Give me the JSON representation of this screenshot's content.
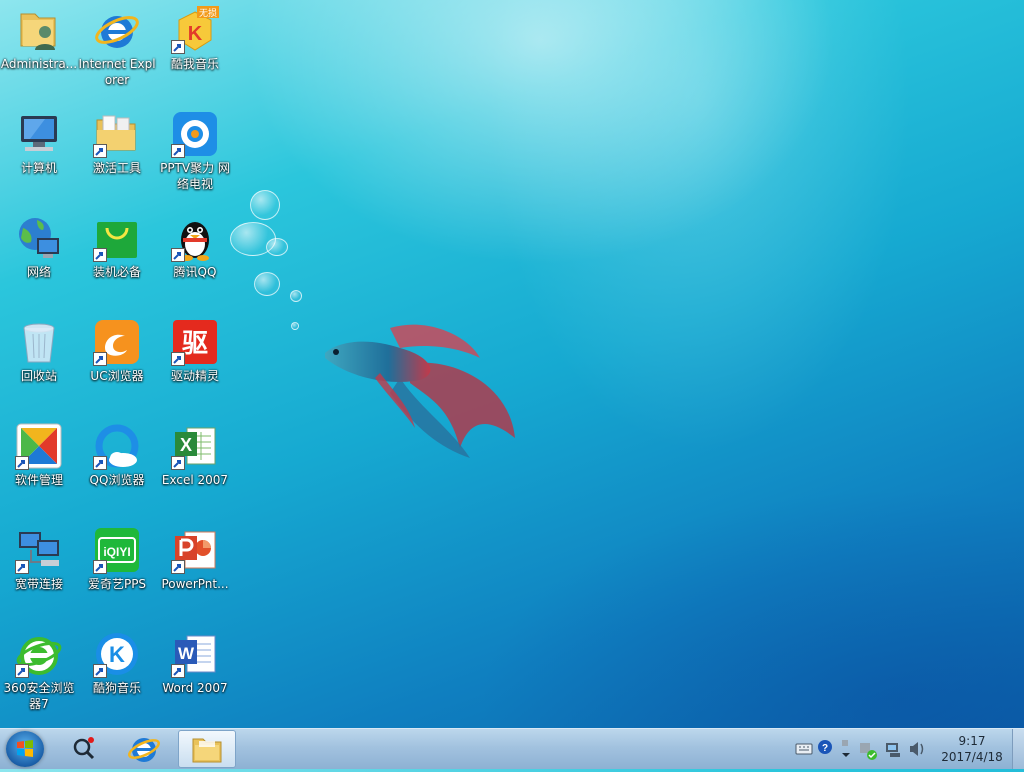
{
  "desktop": {
    "icons": [
      {
        "label": "Administra...",
        "icon": "user-folder-icon"
      },
      {
        "label": "Internet Explorer",
        "icon": "ie-icon"
      },
      {
        "label": "酷我音乐",
        "icon": "kuwo-music-icon",
        "badge": "无损"
      },
      {
        "label": "计算机",
        "icon": "computer-icon"
      },
      {
        "label": "激活工具",
        "icon": "folder-icon"
      },
      {
        "label": "PPTV聚力 网络电视",
        "icon": "pptv-icon"
      },
      {
        "label": "网络",
        "icon": "network-icon"
      },
      {
        "label": "装机必备",
        "icon": "shopping-bag-icon"
      },
      {
        "label": "腾讯QQ",
        "icon": "qq-penguin-icon"
      },
      {
        "label": "回收站",
        "icon": "recycle-bin-icon"
      },
      {
        "label": "UC浏览器",
        "icon": "uc-browser-icon"
      },
      {
        "label": "驱动精灵",
        "icon": "driver-genius-icon",
        "glyph": "驱"
      },
      {
        "label": "软件管理",
        "icon": "software-manager-icon"
      },
      {
        "label": "QQ浏览器",
        "icon": "qq-browser-icon"
      },
      {
        "label": "Excel 2007",
        "icon": "excel-icon",
        "glyph": "X"
      },
      {
        "label": "宽带连接",
        "icon": "broadband-icon"
      },
      {
        "label": "爱奇艺PPS",
        "icon": "iqiyi-icon",
        "glyph": "iQIYI"
      },
      {
        "label": "PowerPnt...",
        "icon": "powerpoint-icon"
      },
      {
        "label": "360安全浏览器7",
        "icon": "360-browser-icon"
      },
      {
        "label": "酷狗音乐",
        "icon": "kugou-icon",
        "glyph": "K"
      },
      {
        "label": "Word 2007",
        "icon": "word-icon",
        "glyph": "W"
      }
    ]
  },
  "taskbar": {
    "start": {
      "icon": "windows-start-icon"
    },
    "pinned": [
      {
        "name": "search",
        "icon": "search-icon"
      },
      {
        "name": "internet-explorer",
        "icon": "ie-icon"
      },
      {
        "name": "explorer",
        "icon": "folder-icon"
      }
    ],
    "tray": {
      "icons": [
        "keyboard-icon",
        "help-icon",
        "show-hidden-icon",
        "security-icon",
        "network-icon",
        "volume-icon"
      ],
      "time": "9:17",
      "date": "2017/4/18"
    }
  },
  "colors": {
    "accent": "#1b5fa8",
    "taskbar": "#a2c2df"
  }
}
